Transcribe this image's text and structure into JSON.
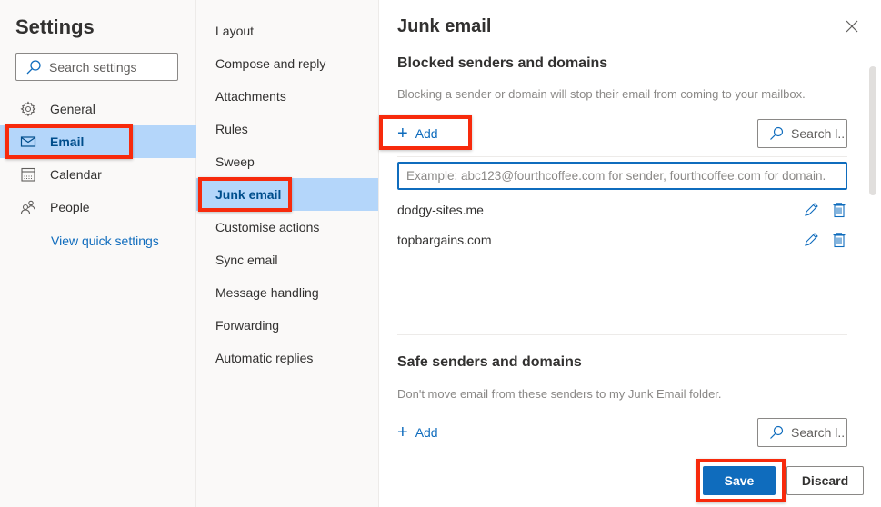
{
  "settings": {
    "title": "Settings",
    "search_placeholder": "Search settings",
    "nav": [
      {
        "label": "General",
        "icon": "gear-icon",
        "selected": false
      },
      {
        "label": "Email",
        "icon": "mail-icon",
        "selected": true
      },
      {
        "label": "Calendar",
        "icon": "calendar-icon",
        "selected": false
      },
      {
        "label": "People",
        "icon": "people-icon",
        "selected": false
      }
    ],
    "quick_settings_link": "View quick settings"
  },
  "email_subnav": {
    "items": [
      {
        "label": "Layout",
        "selected": false
      },
      {
        "label": "Compose and reply",
        "selected": false
      },
      {
        "label": "Attachments",
        "selected": false
      },
      {
        "label": "Rules",
        "selected": false
      },
      {
        "label": "Sweep",
        "selected": false
      },
      {
        "label": "Junk email",
        "selected": true
      },
      {
        "label": "Customise actions",
        "selected": false
      },
      {
        "label": "Sync email",
        "selected": false
      },
      {
        "label": "Message handling",
        "selected": false
      },
      {
        "label": "Forwarding",
        "selected": false
      },
      {
        "label": "Automatic replies",
        "selected": false
      }
    ]
  },
  "panel": {
    "title": "Junk email",
    "close_icon": "close-icon",
    "blocked": {
      "title": "Blocked senders and domains",
      "description": "Blocking a sender or domain will stop their email from coming to your mailbox.",
      "add_label": "Add",
      "search_placeholder": "Search l...",
      "input_placeholder": "Example: abc123@fourthcoffee.com for sender, fourthcoffee.com for domain.",
      "input_value": "",
      "entries": [
        {
          "name": "dodgy-sites.me"
        },
        {
          "name": "topbargains.com"
        }
      ]
    },
    "safe": {
      "title": "Safe senders and domains",
      "description": "Don't move email from these senders to my Junk Email folder.",
      "add_label": "Add",
      "search_placeholder": "Search l..."
    },
    "footer": {
      "save_label": "Save",
      "discard_label": "Discard"
    }
  },
  "colors": {
    "accent": "#0f6cbd",
    "selected_bg": "#b4d6fa",
    "highlight_box": "#f72a0c"
  }
}
